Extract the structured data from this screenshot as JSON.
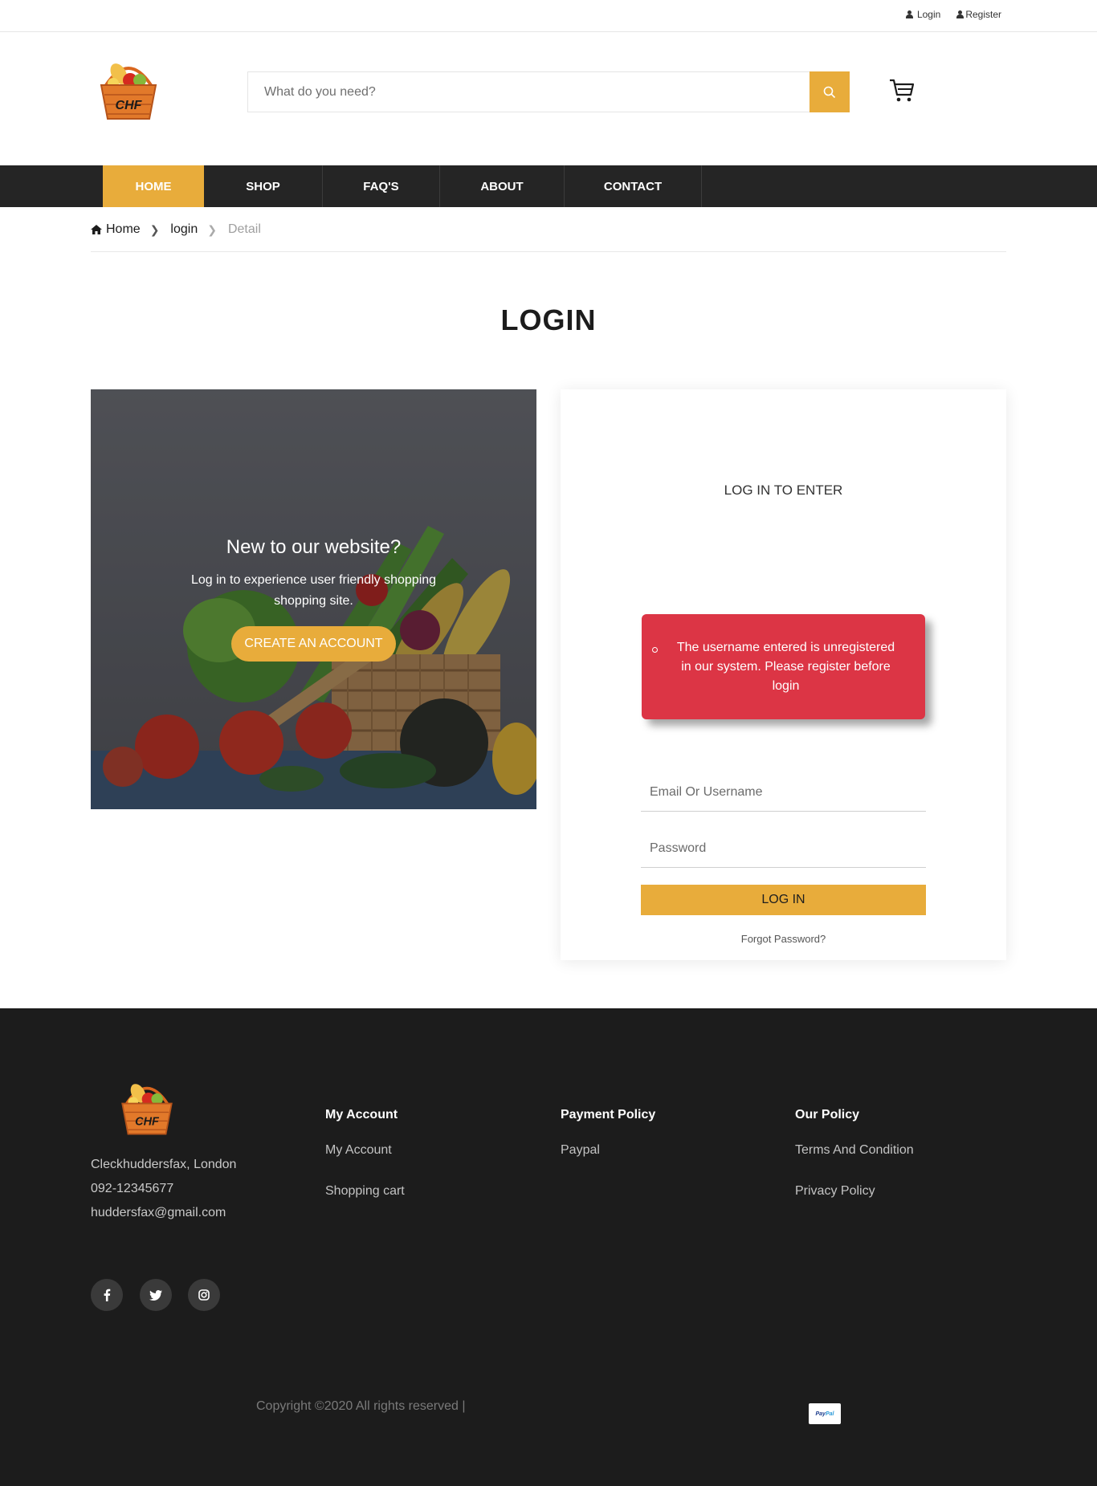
{
  "topbar": {
    "login_label": "Login",
    "register_label": "Register"
  },
  "header": {
    "logo_text": "CHF",
    "search_placeholder": "What do you need?",
    "search_icon": "search-icon",
    "cart_icon": "cart-icon"
  },
  "nav": {
    "items": [
      "HOME",
      "SHOP",
      "FAQ'S",
      "ABOUT",
      "CONTACT"
    ],
    "active": "HOME"
  },
  "breadcrumb": {
    "home": "Home",
    "middle": "login",
    "current": "Detail"
  },
  "page_title": "LOGIN",
  "hero": {
    "heading": "New to our website?",
    "text": "Log in to experience user friendly shopping shopping site.",
    "button": "CREATE AN ACCOUNT"
  },
  "login_card": {
    "subtitle": "LOG IN TO ENTER",
    "error_message": "The username entered is unregistered in our system. Please register before login",
    "email_placeholder": "Email Or Username",
    "password_placeholder": "Password",
    "login_button": "LOG IN",
    "forgot_password": "Forgot Password?"
  },
  "footer": {
    "logo_text": "CHF",
    "address": "Cleckhuddersfax, London",
    "phone": "092-12345677",
    "email": "huddersfax@gmail.com",
    "columns": [
      {
        "title": "My Account",
        "links": [
          "My Account",
          "Shopping cart"
        ]
      },
      {
        "title": "Payment Policy",
        "links": [
          "Paypal"
        ]
      },
      {
        "title": "Our Policy",
        "links": [
          "Terms And Condition",
          "Privacy Policy"
        ]
      }
    ],
    "social": [
      "facebook-icon",
      "twitter-icon",
      "instagram-icon"
    ],
    "copyright": "Copyright ©2020 All rights reserved |",
    "payment_badge": {
      "pay": "Pay",
      "pal": "Pal"
    }
  },
  "colors": {
    "accent": "#e8ac3b",
    "nav_bg": "#252525",
    "footer_bg": "#1c1c1c",
    "alert": "#dc3545"
  }
}
